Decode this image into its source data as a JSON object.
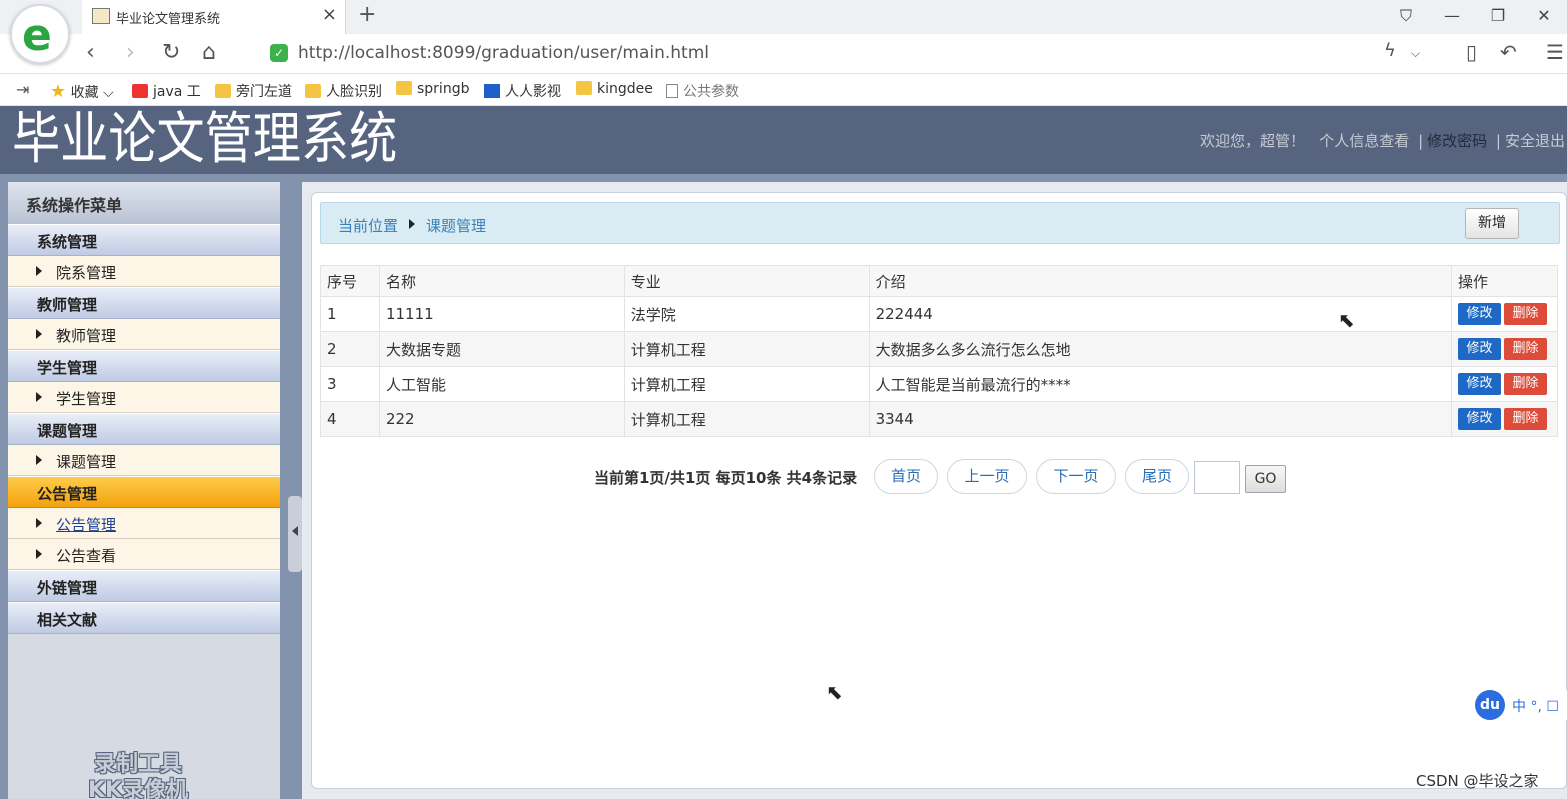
{
  "browser": {
    "logo_letter": "e",
    "tab_title": "毕业论文管理系统",
    "tab_close": "×",
    "new_tab": "+",
    "window_controls": [
      "⛉",
      "—",
      "❐",
      "✕"
    ],
    "nav": {
      "back": "‹",
      "forward": "›",
      "reload": "↻",
      "home": "⌂"
    },
    "shield": "✓",
    "url": "http://localhost:8099/graduation/user/main.html",
    "right_icons": {
      "lightning": "ϟ",
      "dropdown": "⌵",
      "device": "▯",
      "undo": "↶",
      "menu": "☰"
    },
    "bookmarks": [
      {
        "label": "收藏",
        "icon": "star-icon"
      },
      {
        "label": "java 工",
        "icon": "csdn-icon"
      },
      {
        "label": "旁门左道",
        "icon": "folder-icon"
      },
      {
        "label": "人脸识别",
        "icon": "folder-icon"
      },
      {
        "label": "springb",
        "icon": "folder-icon"
      },
      {
        "label": "人人影视",
        "icon": "site-icon"
      },
      {
        "label": "kingdee",
        "icon": "folder-icon"
      },
      {
        "label": "公共参数",
        "icon": "page-icon"
      }
    ]
  },
  "header": {
    "title": "毕业论文管理系统",
    "welcome": "欢迎您，超管！",
    "profile_link": "个人信息查看",
    "password_link": "修改密码",
    "logout_link": "安全退出",
    "separator": "|"
  },
  "sidebar": {
    "title": "系统操作菜单",
    "groups": [
      {
        "label": "系统管理",
        "items": [
          "院系管理"
        ]
      },
      {
        "label": "教师管理",
        "items": [
          "教师管理"
        ]
      },
      {
        "label": "学生管理",
        "items": [
          "学生管理"
        ]
      },
      {
        "label": "课题管理",
        "items": [
          "课题管理"
        ]
      },
      {
        "label": "公告管理",
        "items": [
          "公告管理",
          "公告查看"
        ]
      },
      {
        "label": "外链管理",
        "items": []
      },
      {
        "label": "相关文献",
        "items": []
      }
    ],
    "watermark": [
      "录制工具",
      "KK录像机"
    ]
  },
  "breadcrumb": {
    "root": "当前位置",
    "current": "课题管理",
    "add_button": "新增"
  },
  "table": {
    "columns": [
      "序号",
      "名称",
      "专业",
      "介绍",
      "操作"
    ],
    "rows": [
      [
        "1",
        "11111",
        "法学院",
        "222444"
      ],
      [
        "2",
        "大数据专题",
        "计算机工程",
        "大数据多么多么流行怎么怎地"
      ],
      [
        "3",
        "人工智能",
        "计算机工程",
        "人工智能是当前最流行的****"
      ],
      [
        "4",
        "222",
        "计算机工程",
        "3344"
      ]
    ],
    "edit_label": "修改",
    "delete_label": "删除"
  },
  "pager": {
    "info": "当前第1页/共1页  每页10条  共4条记录",
    "first": "首页",
    "prev": "上一页",
    "next": "下一页",
    "last": "尾页",
    "go": "GO"
  },
  "ime": {
    "badge": "du",
    "text": "中 °, ☐"
  },
  "footer_watermark": "CSDN @毕设之家",
  "colors": {
    "header": "#56647f",
    "active_group": "#f2a20c",
    "edit": "#1e69c5",
    "delete": "#dd4b39"
  }
}
